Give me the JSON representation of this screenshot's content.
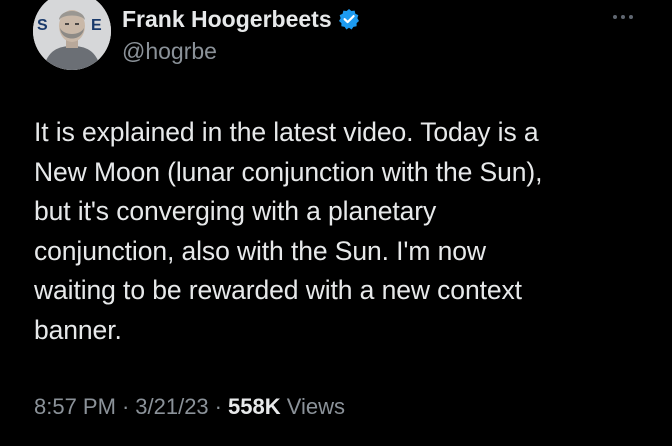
{
  "author": {
    "display_name": "Frank Hoogerbeets",
    "handle": "@hogrbe",
    "verified": true,
    "avatar_text": "S",
    "avatar_text_2": "E"
  },
  "tweet": {
    "text_lines": [
      "It is explained in the latest video. Today is a",
      "New Moon (lunar conjunction with the Sun),",
      "but it's converging with a planetary",
      "conjunction, also with the Sun. I'm now",
      "waiting to be rewarded with a new context",
      "banner."
    ]
  },
  "meta": {
    "time": "8:57 PM",
    "separator": "·",
    "date": "3/21/23",
    "views_count": "558K",
    "views_label": "Views"
  },
  "colors": {
    "background": "#000000",
    "text_primary": "#e7e9ea",
    "text_secondary": "#8b9299",
    "verified_blue": "#1d9bf0"
  },
  "icons": {
    "verified": "verified-badge-icon",
    "more": "more-options-icon"
  }
}
